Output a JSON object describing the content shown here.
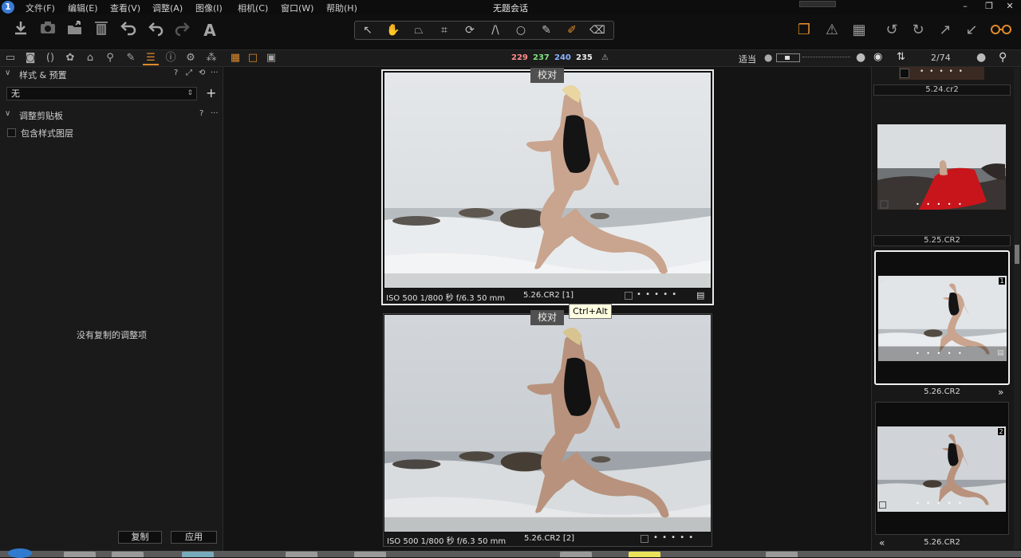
{
  "app": {
    "window_title": "无题会话",
    "logo_char": "1"
  },
  "menu": [
    "文件(F)",
    "编辑(E)",
    "查看(V)",
    "调整(A)",
    "图像(I)",
    "相机(C)",
    "窗口(W)",
    "帮助(H)"
  ],
  "window_controls": [
    "–",
    "❐",
    "✕"
  ],
  "toolbar": {
    "left_icons": [
      "import-icon",
      "camera-icon",
      "export-icon",
      "trash-icon",
      "undo-all-icon",
      "undo-icon",
      "redo-icon",
      "text-icon"
    ],
    "cursor_tools": [
      "select-icon",
      "pan-icon",
      "keystone-icon",
      "crop-icon",
      "rotate-icon",
      "straighten-icon",
      "circle-icon",
      "brush-icon",
      "magic-brush-icon",
      "eraser-icon"
    ],
    "right_icons": [
      "stack-icon",
      "warning-icon",
      "grid-icon",
      "rotate-left-icon",
      "rotate-right-icon",
      "arrow-up-right-icon",
      "arrow-down-left-icon",
      "glasses-icon"
    ]
  },
  "tabbar": {
    "tool_tabs": [
      "folder-tab",
      "camera-tab",
      "lens-tab",
      "color-tab",
      "exposure-tab",
      "zoom-tab",
      "pen-tab",
      "adjustments-tab",
      "info-tab",
      "settings-tab",
      "batch-tab"
    ],
    "view_modes": [
      "grid-view",
      "single-view",
      "compare-view"
    ],
    "rgb": {
      "r": "229",
      "g": "237",
      "b": "240",
      "l": "235"
    },
    "fit_label": "适当",
    "counter": "2/74"
  },
  "left_panel": {
    "styles_section": {
      "title": "样式 & 预置",
      "icons": [
        "?",
        "⤢",
        "⟲",
        "···"
      ],
      "select_value": "无",
      "add": "+"
    },
    "clipboard_section": {
      "title": "调整剪贴板",
      "icons": [
        "?",
        "···"
      ],
      "checkbox_label": "包含样式图层"
    },
    "empty_message": "没有复制的调整项",
    "copy_button": "复制",
    "apply_button": "应用"
  },
  "viewer": {
    "badge": "校对",
    "tooltip": "Ctrl+Alt",
    "images": [
      {
        "exif": "ISO 500 1/800 秒 f/6.3 50 mm",
        "name": "5.26.CR2 [1]"
      },
      {
        "exif": "ISO 500 1/800 秒 f/6.3 50 mm",
        "name": "5.26.CR2 [2]"
      }
    ],
    "dots": "• • • • •"
  },
  "browser": {
    "files": [
      "5.24.cr2",
      "5.25.CR2",
      "5.26.CR2",
      "5.26.CR2"
    ],
    "thumb_numbers": [
      "1",
      "2"
    ],
    "nav_next": "»",
    "nav_prev": "«",
    "dots": "• • • • •"
  },
  "colors": {
    "accent_orange": "#e08a2a",
    "r": "#ff8c8c",
    "g": "#7fe07f",
    "b": "#8ab4ff"
  }
}
